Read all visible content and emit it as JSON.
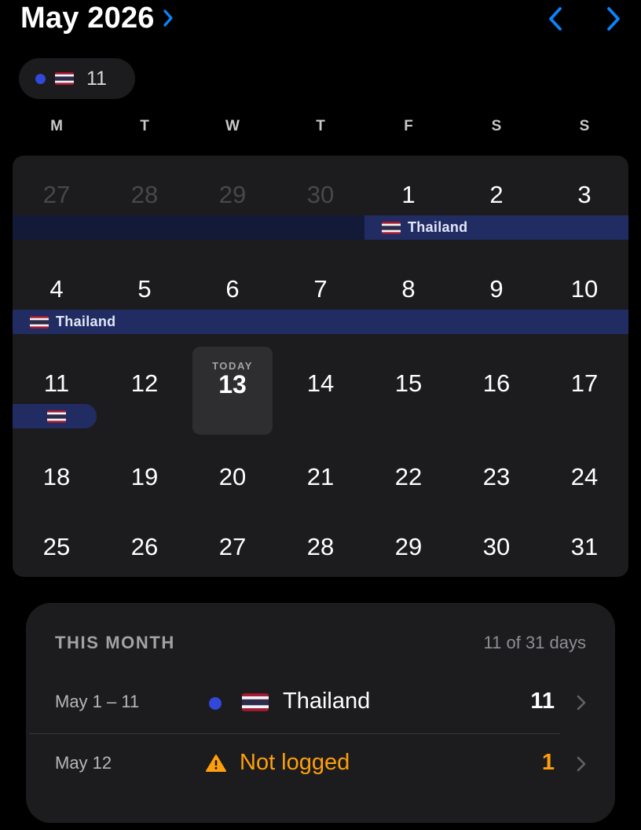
{
  "header": {
    "title": "May 2026",
    "title_chevron_icon": "chevron-right-icon",
    "prev_icon": "chevron-left-icon",
    "next_icon": "chevron-right-icon"
  },
  "filter_chip": {
    "count": "11",
    "dot_color": "#3348d8",
    "flag_icon": "thailand-flag-icon"
  },
  "weekdays": [
    "M",
    "T",
    "W",
    "T",
    "F",
    "S",
    "S"
  ],
  "calendar": {
    "weeks": [
      [
        "27",
        "28",
        "29",
        "30",
        "1",
        "2",
        "3"
      ],
      [
        "4",
        "5",
        "6",
        "7",
        "8",
        "9",
        "10"
      ],
      [
        "11",
        "12",
        "13",
        "14",
        "15",
        "16",
        "17"
      ],
      [
        "18",
        "19",
        "20",
        "21",
        "22",
        "23",
        "24"
      ],
      [
        "25",
        "26",
        "27",
        "28",
        "29",
        "30",
        "31"
      ]
    ],
    "outside_month": [
      "27",
      "28",
      "29",
      "30"
    ],
    "today_label": "TODAY",
    "today_day": "13",
    "trip_label": "Thailand"
  },
  "summary": {
    "title": "THIS MONTH",
    "days_summary": "11 of 31 days",
    "rows": [
      {
        "date": "May 1 – 11",
        "country": "Thailand",
        "count": "11",
        "dot_color": "#3348d8",
        "flag_icon": "thailand-flag-icon"
      },
      {
        "date": "May 12",
        "status": "Not logged",
        "count": "1",
        "status_color": "#ff9f0a",
        "icon": "warning-icon"
      }
    ]
  },
  "colors": {
    "accent": "#0a84ff",
    "warning": "#ff9f0a",
    "trip_band": "#212c63",
    "card": "#1c1c1e"
  }
}
